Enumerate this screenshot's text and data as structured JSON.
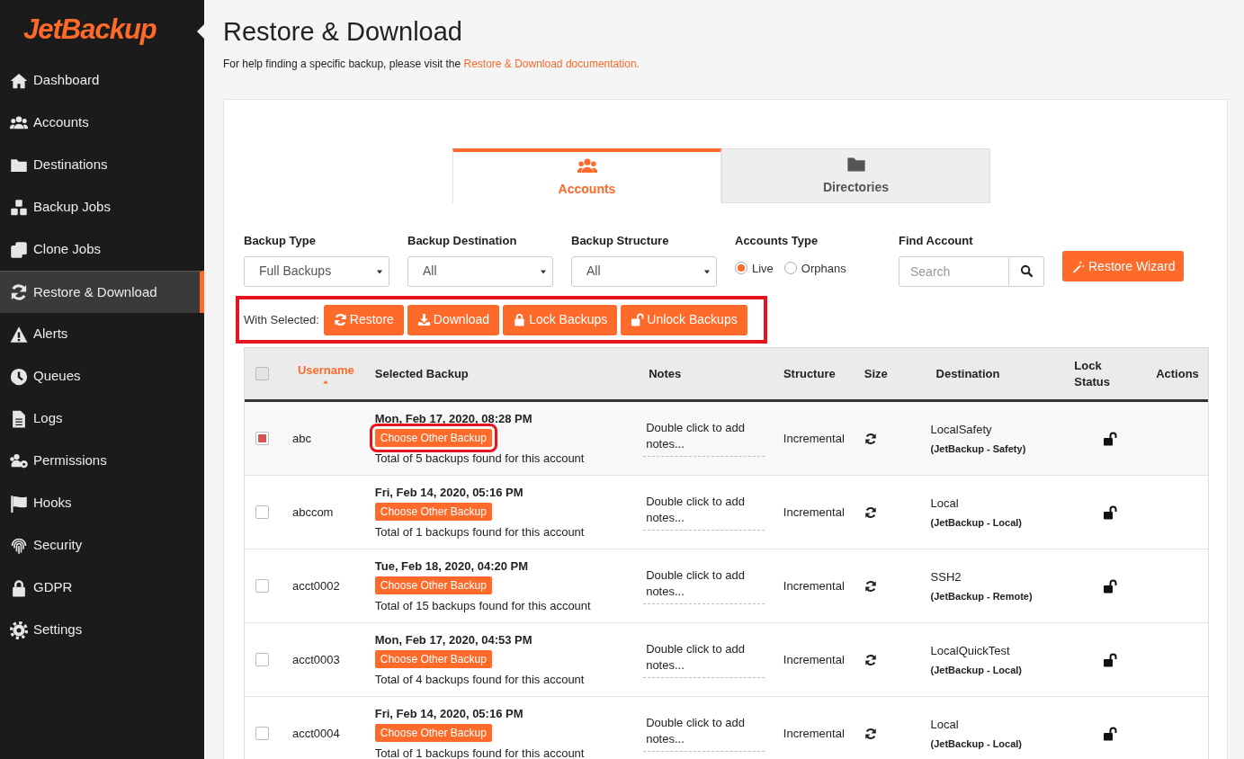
{
  "sidebar": {
    "logo": "JetBackup",
    "items": [
      {
        "label": "Dashboard",
        "selected": false
      },
      {
        "label": "Accounts",
        "selected": false
      },
      {
        "label": "Destinations",
        "selected": false
      },
      {
        "label": "Backup Jobs",
        "selected": false
      },
      {
        "label": "Clone Jobs",
        "selected": false
      },
      {
        "label": "Restore & Download",
        "selected": true
      },
      {
        "label": "Alerts",
        "selected": false
      },
      {
        "label": "Queues",
        "selected": false
      },
      {
        "label": "Logs",
        "selected": false
      },
      {
        "label": "Permissions",
        "selected": false
      },
      {
        "label": "Hooks",
        "selected": false
      },
      {
        "label": "Security",
        "selected": false
      },
      {
        "label": "GDPR",
        "selected": false
      },
      {
        "label": "Settings",
        "selected": false
      }
    ]
  },
  "page": {
    "title": "Restore & Download",
    "help_text": "For help finding a specific backup, please visit the",
    "help_link": "Restore & Download documentation."
  },
  "tabs": [
    {
      "label": "Accounts",
      "selected": true
    },
    {
      "label": "Directories",
      "selected": false
    }
  ],
  "filters": {
    "selects": [
      {
        "label": "Backup Type",
        "value": "Full Backups"
      },
      {
        "label": "Backup Destination",
        "value": "All"
      },
      {
        "label": "Backup Structure",
        "value": "All"
      }
    ],
    "accounts_type": {
      "label": "Accounts Type",
      "options": [
        {
          "label": "Live",
          "selected": true
        },
        {
          "label": "Orphans",
          "selected": false
        }
      ]
    },
    "find_account": {
      "label": "Find Account",
      "placeholder": "Search"
    },
    "wizard_button": "Restore Wizard"
  },
  "bulk_actions": {
    "label": "With Selected:",
    "buttons": [
      "Restore",
      "Download",
      "Lock Backups",
      "Unlock Backups"
    ]
  },
  "table": {
    "select_all": {
      "checked": false
    },
    "columns": [
      "Username",
      "Selected Backup",
      "Notes",
      "Structure",
      "Size",
      "Destination",
      "Lock Status",
      "Actions"
    ],
    "rows": [
      {
        "checked": true,
        "username": "abc",
        "date": "Mon, Feb 17, 2020, 08:28 PM",
        "choose": "Choose Other Backup",
        "total": "Total of 5 backups found for this account",
        "notes": "Double click to add notes...",
        "structure": "Incremental",
        "destination": "LocalSafety",
        "destination_detail": "(JetBackup - Safety)",
        "locked": false
      },
      {
        "checked": false,
        "username": "abccom",
        "date": "Fri, Feb 14, 2020, 05:16 PM",
        "choose": "Choose Other Backup",
        "total": "Total of 1 backups found for this account",
        "notes": "Double click to add notes...",
        "structure": "Incremental",
        "destination": "Local",
        "destination_detail": "(JetBackup - Local)",
        "locked": false
      },
      {
        "checked": false,
        "username": "acct0002",
        "date": "Tue, Feb 18, 2020, 04:20 PM",
        "choose": "Choose Other Backup",
        "total": "Total of 15 backups found for this account",
        "notes": "Double click to add notes...",
        "structure": "Incremental",
        "destination": "SSH2",
        "destination_detail": "(JetBackup - Remote)",
        "locked": false
      },
      {
        "checked": false,
        "username": "acct0003",
        "date": "Mon, Feb 17, 2020, 04:53 PM",
        "choose": "Choose Other Backup",
        "total": "Total of 4 backups found for this account",
        "notes": "Double click to add notes...",
        "structure": "Incremental",
        "destination": "LocalQuickTest",
        "destination_detail": "(JetBackup - Local)",
        "locked": false
      },
      {
        "checked": false,
        "username": "acct0004",
        "date": "Fri, Feb 14, 2020, 05:16 PM",
        "choose": "Choose Other Backup",
        "total": "Total of 1 backups found for this account",
        "notes": "Double click to add notes...",
        "structure": "Incremental",
        "destination": "Local",
        "destination_detail": "(JetBackup - Local)",
        "locked": false
      }
    ]
  }
}
